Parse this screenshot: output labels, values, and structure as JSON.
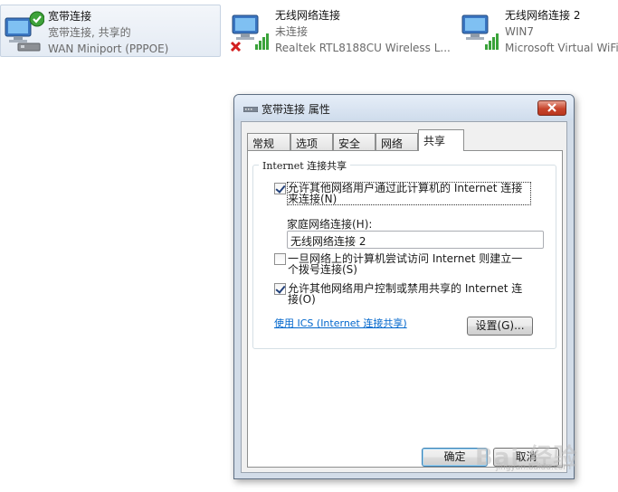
{
  "connections": [
    {
      "name": "宽带连接",
      "status": "宽带连接, 共享的",
      "device": "WAN Miniport (PPPOE)",
      "icon": "network-connected-icon"
    },
    {
      "name": "无线网络连接",
      "status": "未连接",
      "device": "Realtek RTL8188CU Wireless L...",
      "icon": "network-disconnected-icon"
    },
    {
      "name": "无线网络连接 2",
      "status": "WIN7",
      "device": "Microsoft Virtual WiFi",
      "icon": "wireless-network-icon"
    }
  ],
  "dialog": {
    "title": "宽带连接 属性",
    "tabs": [
      "常规",
      "选项",
      "安全",
      "网络",
      "共享"
    ],
    "active_tab": "共享",
    "group_title": "Internet 连接共享",
    "allow_share_label": "允许其他网络用户通过此计算机的 Internet 连接来连接(N)",
    "allow_share_checked": true,
    "home_conn_label": "家庭网络连接(H):",
    "home_conn_value": "无线网络连接 2",
    "dial_on_demand_label": "一旦网络上的计算机尝试访问 Internet 则建立一个拨号连接(S)",
    "dial_on_demand_checked": false,
    "allow_control_label": "允许其他网络用户控制或禁用共享的 Internet 连接(O)",
    "allow_control_checked": true,
    "ics_link": "使用 ICS (Internet 连接共享)",
    "settings_button": "设置(G)...",
    "ok_button": "确定",
    "cancel_button": "取消"
  },
  "watermark": {
    "main": "Bai 经验",
    "sub": "jingyan.baidu.com"
  },
  "colors": {
    "link": "#0066cc",
    "close": "#c7452c",
    "signal": "#3aa33a"
  }
}
